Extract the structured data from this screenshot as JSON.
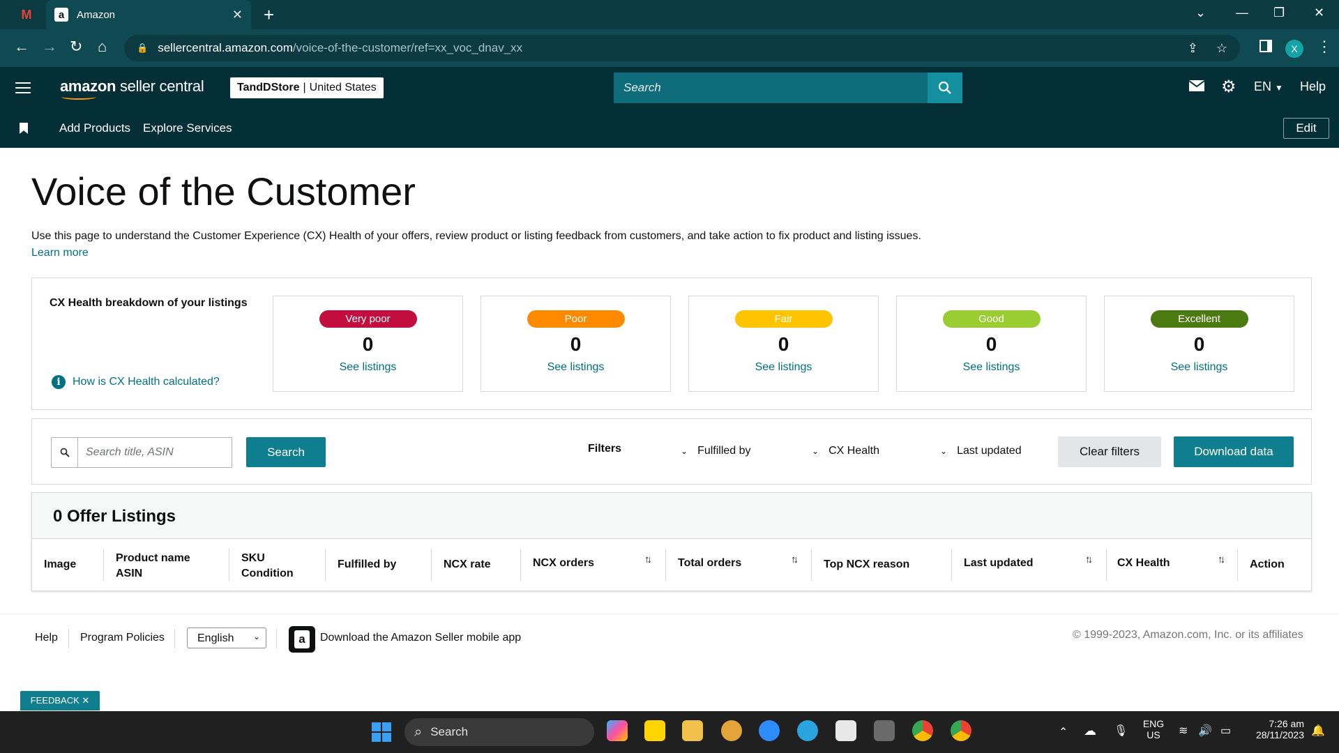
{
  "browser": {
    "tab_title": "Amazon",
    "tab_favicon": "a",
    "gmail_glyph": "M",
    "url_domain": "sellercentral.amazon.com",
    "url_path": "/voice-of-the-customer/ref=xx_voc_dnav_xx",
    "profile_initial": "X"
  },
  "header": {
    "logo_amazon": "amazon",
    "logo_rest": " seller central",
    "store_name": "TandDStore",
    "store_separator": "|",
    "store_region": "United States",
    "search_placeholder": "Search",
    "lang": "EN",
    "help": "Help"
  },
  "nav": {
    "links": [
      "Add Products",
      "Explore Services"
    ],
    "edit": "Edit"
  },
  "page": {
    "title": "Voice of the Customer",
    "description": "Use this page to understand the Customer Experience (CX) Health of your offers, review product or listing feedback from customers, and take action to fix product and listing issues.",
    "learn_more": "Learn more"
  },
  "health": {
    "title": "CX Health breakdown of your listings",
    "help_link": "How is CX Health calculated?",
    "info_glyph": "i",
    "cards": [
      {
        "label": "Very poor",
        "count": "0",
        "link": "See listings",
        "color": "#c40d3f"
      },
      {
        "label": "Poor",
        "count": "0",
        "link": "See listings",
        "color": "#ff8a00"
      },
      {
        "label": "Fair",
        "count": "0",
        "link": "See listings",
        "color": "#ffc400"
      },
      {
        "label": "Good",
        "count": "0",
        "link": "See listings",
        "color": "#9acd32"
      },
      {
        "label": "Excellent",
        "count": "0",
        "link": "See listings",
        "color": "#4b7a10"
      }
    ]
  },
  "filters": {
    "search_placeholder": "Search title, ASIN",
    "search_button": "Search",
    "label": "Filters",
    "fulfilled_by": "Fulfilled by",
    "cx_health": "CX Health",
    "last_updated": "Last updated",
    "clear": "Clear filters",
    "download": "Download data"
  },
  "listings": {
    "heading": "0 Offer Listings",
    "columns": {
      "image": "Image",
      "product_name": "Product name",
      "asin": "ASIN",
      "sku": "SKU",
      "condition": "Condition",
      "fulfilled_by": "Fulfilled by",
      "ncx_rate": "NCX rate",
      "ncx_orders": "NCX orders",
      "total_orders": "Total orders",
      "top_ncx_reason": "Top NCX reason",
      "last_updated": "Last updated",
      "cx_health": "CX Health",
      "action": "Action"
    },
    "sort_glyph": "↑↓"
  },
  "footer": {
    "help": "Help",
    "program_policies": "Program Policies",
    "language": "English",
    "app_glyph": "a",
    "app_link": "Download the Amazon Seller mobile app",
    "copyright": "© 1999-2023, Amazon.com, Inc. or its affiliates"
  },
  "feedback": "FEEDBACK ✕",
  "taskbar": {
    "search": "Search",
    "lang_top": "ENG",
    "lang_bottom": "US",
    "time": "7:26 am",
    "date": "28/11/2023"
  },
  "colors": {
    "chrome_dark": "#0b3a42",
    "chrome_mid": "#0f4a53",
    "seller_header": "#052f36",
    "teal_button": "#0f7e8e",
    "link": "#007185"
  }
}
